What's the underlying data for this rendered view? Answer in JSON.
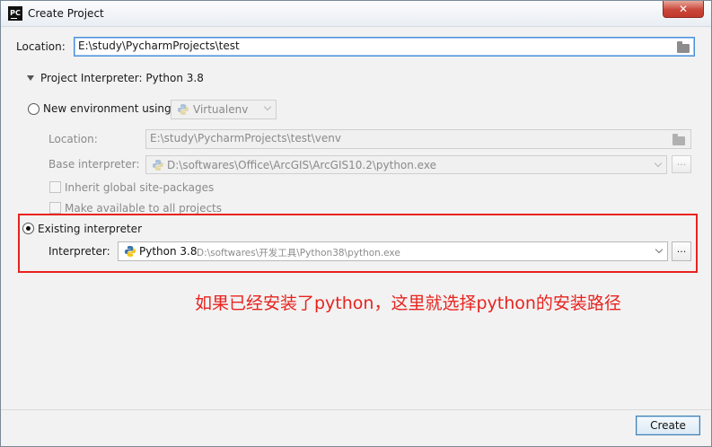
{
  "window": {
    "title": "Create Project",
    "app_icon": "PC",
    "close_glyph": "✕"
  },
  "location": {
    "label": "Location:",
    "value": "E:\\study\\PycharmProjects\\test"
  },
  "interpreter_section": {
    "header": "Project Interpreter: Python 3.8"
  },
  "new_env": {
    "radio_label": "New environment using",
    "tool": "Virtualenv",
    "location_label": "Location:",
    "location_value": "E:\\study\\PycharmProjects\\test\\venv",
    "base_label": "Base interpreter:",
    "base_value": "D:\\softwares\\Office\\ArcGIS\\ArcGIS10.2\\python.exe",
    "browse": "...",
    "inherit_label": "Inherit global site-packages",
    "make_available_label": "Make available to all projects"
  },
  "existing": {
    "radio_label": "Existing interpreter",
    "interpreter_label": "Interpreter:",
    "interpreter_name": "Python 3.8",
    "interpreter_path": "D:\\softwares\\开发工具\\Python38\\python.exe",
    "browse": "..."
  },
  "annotation": "如果已经安装了python，这里就选择python的安装路径",
  "footer": {
    "create_label": "Create"
  },
  "colors": {
    "accent": "#4a90d9",
    "annotation_red": "#e8231f"
  }
}
